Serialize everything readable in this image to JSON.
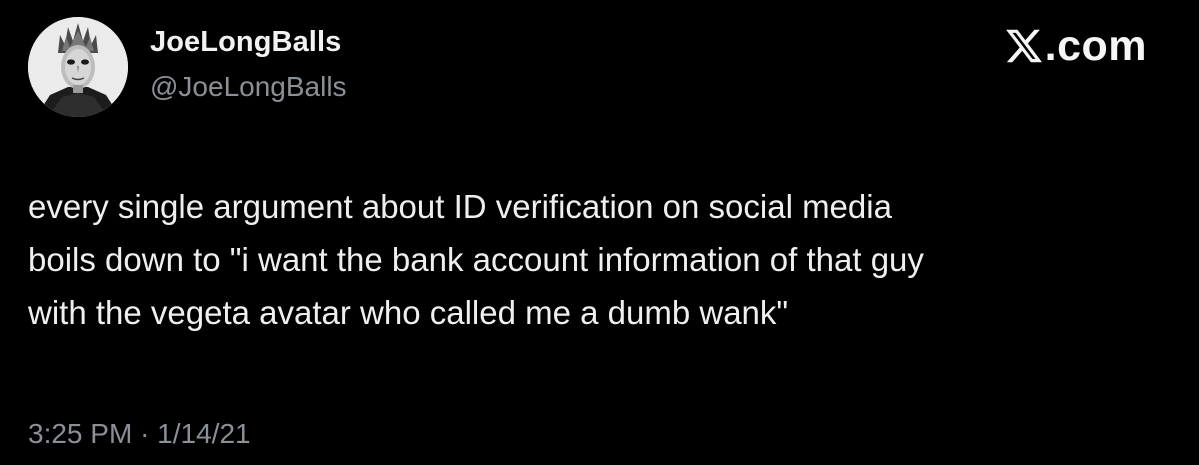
{
  "author": {
    "display_name": "JoeLongBalls",
    "handle": "@JoeLongBalls",
    "avatar_icon": "masked-figure-avatar"
  },
  "brand": {
    "logo_icon": "x-logo-icon",
    "suffix": ".com"
  },
  "tweet": {
    "lines": [
      "every single argument about ID verification on social media",
      "boils down to \"i want the bank account information of that guy",
      "with the vegeta avatar who called me a dumb wank\""
    ],
    "time": "3:25 PM",
    "separator": "·",
    "date": "1/14/21"
  },
  "colors": {
    "background": "#000000",
    "primary_text": "#efefef",
    "secondary_text": "#8b9096"
  }
}
